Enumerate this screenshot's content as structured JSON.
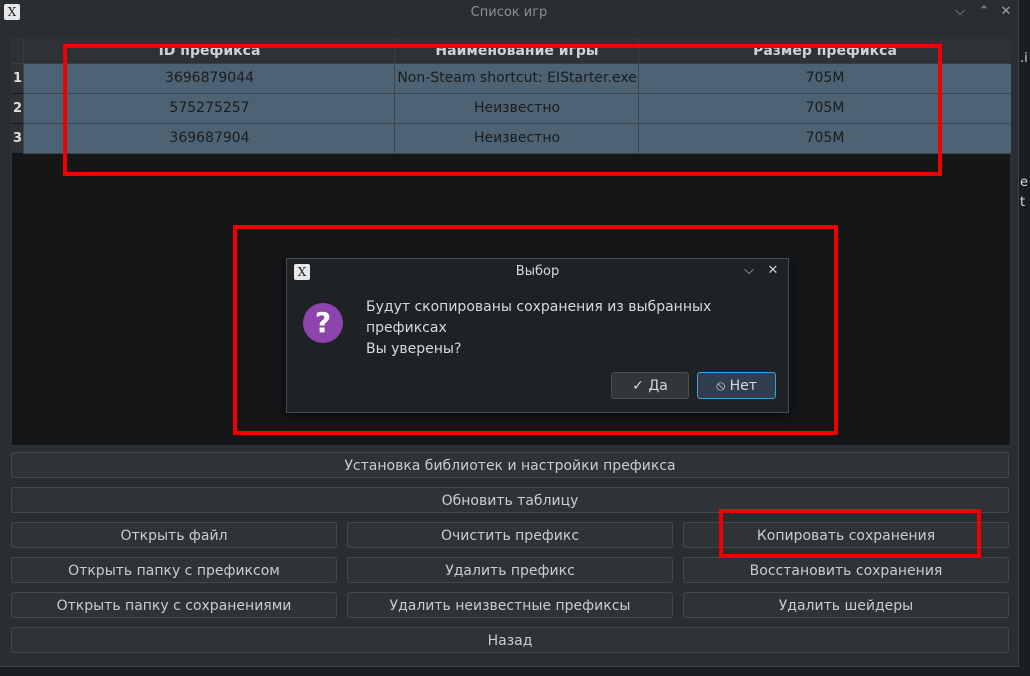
{
  "window": {
    "title": "Список игр",
    "minimize_glyph": "⌵",
    "maximize_glyph": "⌃",
    "close_glyph": "✕",
    "app_icon": "x-logo-icon",
    "app_icon_glyph": "X"
  },
  "table": {
    "headers": [
      "ID префикса",
      "Наименование игры",
      "Размер префикса"
    ],
    "rows": [
      {
        "num": "1",
        "id": "3696879044",
        "name": "Non-Steam shortcut: EIStarter.exe",
        "size": "705M"
      },
      {
        "num": "2",
        "id": "575275257",
        "name": "Неизвестно",
        "size": "705M"
      },
      {
        "num": "3",
        "id": "369687904",
        "name": "Неизвестно",
        "size": "705M"
      }
    ]
  },
  "dialog": {
    "title": "Выбор",
    "message_line1": "Будут скопированы сохранения из выбранных",
    "message_line2": "префиксах",
    "message_line3": "Вы уверены?",
    "icon_glyph": "?",
    "yes_label": "✓ Да",
    "no_label": "⦸ Нет"
  },
  "buttons": {
    "install_libs": "Установка библиотек и настройки префикса",
    "refresh_table": "Обновить таблицу",
    "open_file": "Открыть файл",
    "clear_prefix": "Очистить префикс",
    "copy_saves": "Копировать сохранения",
    "open_prefix_folder": "Открыть папку с префиксом",
    "delete_prefix": "Удалить префикс",
    "restore_saves": "Восстановить сохранения",
    "open_saves_folder": "Открыть папку с сохранениями",
    "delete_unknown_prefixes": "Удалить неизвестные префиксы",
    "delete_shaders": "Удалить шейдеры",
    "back": "Назад"
  },
  "background_window_fragments": [
    ".i",
    "e",
    "t"
  ],
  "colors": {
    "highlight": "#f00000",
    "selection": "#4d6374",
    "question_icon": "#8e44ad",
    "focus": "#3d9ee0"
  }
}
